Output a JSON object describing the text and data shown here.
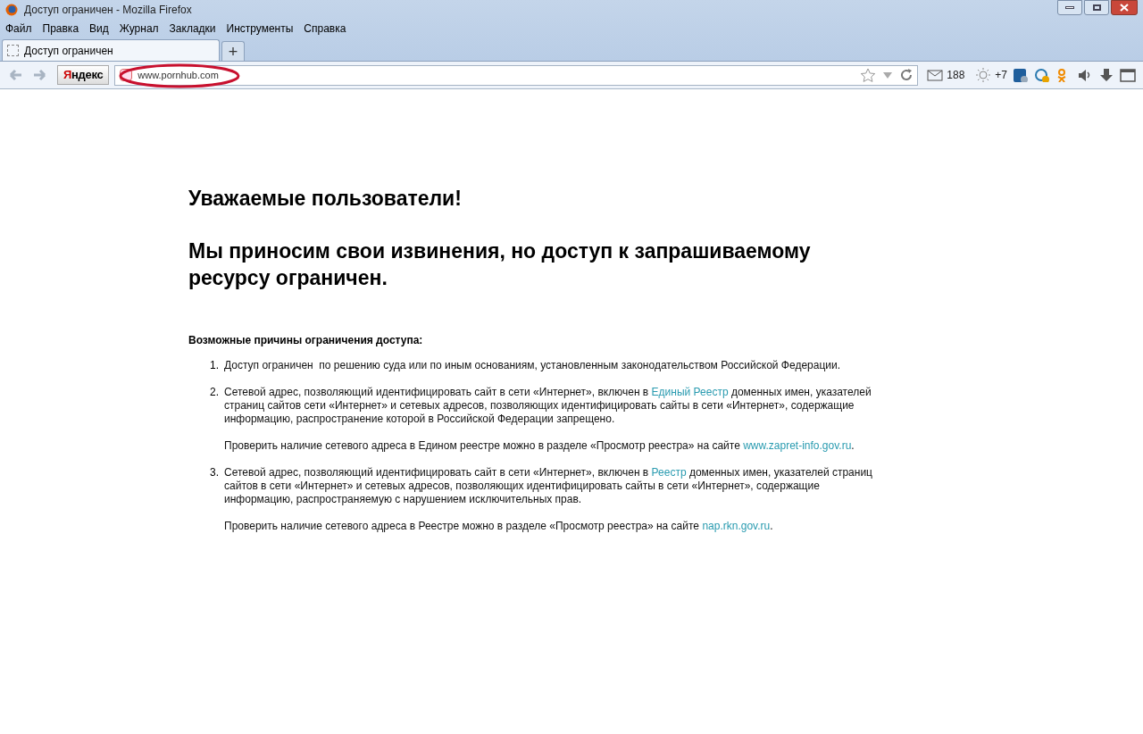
{
  "window": {
    "title": "Доступ ограничен - Mozilla Firefox"
  },
  "menu": [
    "Файл",
    "Правка",
    "Вид",
    "Журнал",
    "Закладки",
    "Инструменты",
    "Справка"
  ],
  "tabs": [
    {
      "label": "Доступ ограничен",
      "selected": true
    }
  ],
  "new_tab": "+",
  "toolbar": {
    "search_engine": "Яндекс",
    "url": "www.pornhub.com",
    "mail_count": "188",
    "weather": "+7"
  },
  "page": {
    "greeting": "Уважаемые пользователи!",
    "apology": "Мы приносим свои извинения, но доступ к запрашиваемому ресурсу ограничен.",
    "reasons_title": "Возможные причины ограничения доступа:",
    "reasons": [
      {
        "number": "1.",
        "paragraphs": [
          [
            {
              "kind": "text",
              "text": "Доступ ограничен  по решению суда или по иным основаниям, установленным законодательством Российской Федерации."
            }
          ]
        ]
      },
      {
        "number": "2.",
        "paragraphs": [
          [
            {
              "kind": "text",
              "text": "Сетевой адрес, позволяющий идентифицировать сайт в сети «Интернет», включен в "
            },
            {
              "kind": "link",
              "text": "Единый Реестр"
            },
            {
              "kind": "text",
              "text": " доменных имен, указателей страниц сайтов сети «Интернет» и сетевых адресов, позволяющих идентифицировать сайты в сети «Интернет», содержащие информацию, распространение которой в Российской Федерации запрещено."
            }
          ],
          [
            {
              "kind": "text",
              "text": "Проверить наличие сетевого адреса в Едином реестре можно в разделе «Просмотр реестра» на сайте "
            },
            {
              "kind": "link",
              "text": "www.zapret-info.gov.ru"
            },
            {
              "kind": "text",
              "text": "."
            }
          ]
        ]
      },
      {
        "number": "3.",
        "paragraphs": [
          [
            {
              "kind": "text",
              "text": "Сетевой адрес, позволяющий идентифицировать сайт в сети «Интернет», включен в "
            },
            {
              "kind": "link",
              "text": "Реестр"
            },
            {
              "kind": "text",
              "text": " доменных имен, указателей страниц сайтов в сети «Интернет» и сетевых адресов, позволяющих идентифицировать сайты в сети «Интернет», содержащие информацию, распространяемую с нарушением исключительных прав."
            }
          ],
          [
            {
              "kind": "text",
              "text": "Проверить наличие сетевого адреса в Реестре можно в разделе «Просмотр реестра» на сайте "
            },
            {
              "kind": "link",
              "text": "nap.rkn.gov.ru"
            },
            {
              "kind": "text",
              "text": "."
            }
          ]
        ]
      }
    ]
  }
}
